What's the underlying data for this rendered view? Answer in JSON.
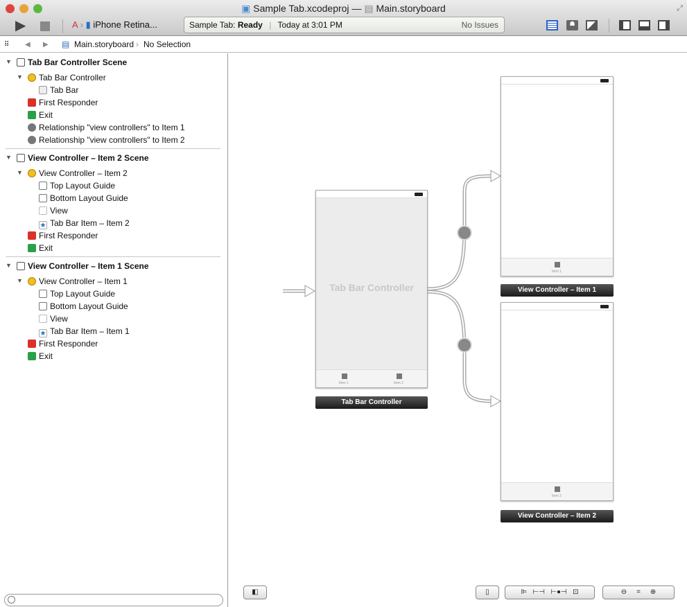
{
  "window": {
    "project": "Sample Tab.xcodeproj",
    "separator": "—",
    "file": "Main.storyboard"
  },
  "toolbar": {
    "scheme": "iPhone Retina...",
    "status_prefix": "Sample Tab: ",
    "status_state": "Ready",
    "status_time": "Today at 3:01 PM",
    "issues": "No Issues"
  },
  "jumpbar": {
    "file": "Main.storyboard",
    "selection": "No Selection"
  },
  "outline": [
    {
      "label": "Tab Bar Controller Scene",
      "type": "scene"
    },
    {
      "label": "Tab Bar Controller",
      "type": "controller"
    },
    {
      "label": "Tab Bar",
      "type": "tabbar"
    },
    {
      "label": "First Responder",
      "type": "responder"
    },
    {
      "label": "Exit",
      "type": "exit"
    },
    {
      "label": "Relationship \"view controllers\" to Item 1",
      "type": "relationship"
    },
    {
      "label": "Relationship \"view controllers\" to Item 2",
      "type": "relationship"
    },
    {
      "label": "View Controller – Item 2 Scene",
      "type": "scene"
    },
    {
      "label": "View Controller – Item 2",
      "type": "controller"
    },
    {
      "label": "Top Layout Guide",
      "type": "guide"
    },
    {
      "label": "Bottom Layout Guide",
      "type": "guide"
    },
    {
      "label": "View",
      "type": "view"
    },
    {
      "label": "Tab Bar Item – Item 2",
      "type": "tabitem"
    },
    {
      "label": "First Responder",
      "type": "responder"
    },
    {
      "label": "Exit",
      "type": "exit"
    },
    {
      "label": "View Controller – Item 1 Scene",
      "type": "scene"
    },
    {
      "label": "View Controller – Item 1",
      "type": "controller"
    },
    {
      "label": "Top Layout Guide",
      "type": "guide"
    },
    {
      "label": "Bottom Layout Guide",
      "type": "guide"
    },
    {
      "label": "View",
      "type": "view"
    },
    {
      "label": "Tab Bar Item – Item 1",
      "type": "tabitem"
    },
    {
      "label": "First Responder",
      "type": "responder"
    },
    {
      "label": "Exit",
      "type": "exit"
    }
  ],
  "canvas": {
    "tbc": {
      "title": "Tab Bar Controller",
      "label": "Tab Bar Controller",
      "tab1": "Item 1",
      "tab2": "Item 2"
    },
    "vc1": {
      "label": "View Controller – Item 1",
      "tab": "Item 1"
    },
    "vc2": {
      "label": "View Controller – Item 2",
      "tab": "Item 2"
    }
  }
}
